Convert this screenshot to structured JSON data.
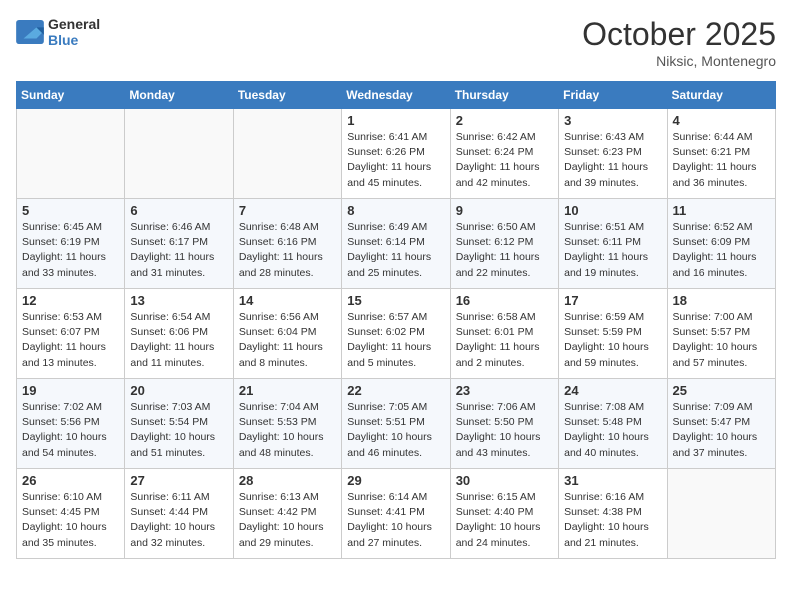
{
  "header": {
    "logo_general": "General",
    "logo_blue": "Blue",
    "month": "October 2025",
    "location": "Niksic, Montenegro"
  },
  "weekdays": [
    "Sunday",
    "Monday",
    "Tuesday",
    "Wednesday",
    "Thursday",
    "Friday",
    "Saturday"
  ],
  "weeks": [
    [
      {
        "day": "",
        "info": ""
      },
      {
        "day": "",
        "info": ""
      },
      {
        "day": "",
        "info": ""
      },
      {
        "day": "1",
        "info": "Sunrise: 6:41 AM\nSunset: 6:26 PM\nDaylight: 11 hours\nand 45 minutes."
      },
      {
        "day": "2",
        "info": "Sunrise: 6:42 AM\nSunset: 6:24 PM\nDaylight: 11 hours\nand 42 minutes."
      },
      {
        "day": "3",
        "info": "Sunrise: 6:43 AM\nSunset: 6:23 PM\nDaylight: 11 hours\nand 39 minutes."
      },
      {
        "day": "4",
        "info": "Sunrise: 6:44 AM\nSunset: 6:21 PM\nDaylight: 11 hours\nand 36 minutes."
      }
    ],
    [
      {
        "day": "5",
        "info": "Sunrise: 6:45 AM\nSunset: 6:19 PM\nDaylight: 11 hours\nand 33 minutes."
      },
      {
        "day": "6",
        "info": "Sunrise: 6:46 AM\nSunset: 6:17 PM\nDaylight: 11 hours\nand 31 minutes."
      },
      {
        "day": "7",
        "info": "Sunrise: 6:48 AM\nSunset: 6:16 PM\nDaylight: 11 hours\nand 28 minutes."
      },
      {
        "day": "8",
        "info": "Sunrise: 6:49 AM\nSunset: 6:14 PM\nDaylight: 11 hours\nand 25 minutes."
      },
      {
        "day": "9",
        "info": "Sunrise: 6:50 AM\nSunset: 6:12 PM\nDaylight: 11 hours\nand 22 minutes."
      },
      {
        "day": "10",
        "info": "Sunrise: 6:51 AM\nSunset: 6:11 PM\nDaylight: 11 hours\nand 19 minutes."
      },
      {
        "day": "11",
        "info": "Sunrise: 6:52 AM\nSunset: 6:09 PM\nDaylight: 11 hours\nand 16 minutes."
      }
    ],
    [
      {
        "day": "12",
        "info": "Sunrise: 6:53 AM\nSunset: 6:07 PM\nDaylight: 11 hours\nand 13 minutes."
      },
      {
        "day": "13",
        "info": "Sunrise: 6:54 AM\nSunset: 6:06 PM\nDaylight: 11 hours\nand 11 minutes."
      },
      {
        "day": "14",
        "info": "Sunrise: 6:56 AM\nSunset: 6:04 PM\nDaylight: 11 hours\nand 8 minutes."
      },
      {
        "day": "15",
        "info": "Sunrise: 6:57 AM\nSunset: 6:02 PM\nDaylight: 11 hours\nand 5 minutes."
      },
      {
        "day": "16",
        "info": "Sunrise: 6:58 AM\nSunset: 6:01 PM\nDaylight: 11 hours\nand 2 minutes."
      },
      {
        "day": "17",
        "info": "Sunrise: 6:59 AM\nSunset: 5:59 PM\nDaylight: 10 hours\nand 59 minutes."
      },
      {
        "day": "18",
        "info": "Sunrise: 7:00 AM\nSunset: 5:57 PM\nDaylight: 10 hours\nand 57 minutes."
      }
    ],
    [
      {
        "day": "19",
        "info": "Sunrise: 7:02 AM\nSunset: 5:56 PM\nDaylight: 10 hours\nand 54 minutes."
      },
      {
        "day": "20",
        "info": "Sunrise: 7:03 AM\nSunset: 5:54 PM\nDaylight: 10 hours\nand 51 minutes."
      },
      {
        "day": "21",
        "info": "Sunrise: 7:04 AM\nSunset: 5:53 PM\nDaylight: 10 hours\nand 48 minutes."
      },
      {
        "day": "22",
        "info": "Sunrise: 7:05 AM\nSunset: 5:51 PM\nDaylight: 10 hours\nand 46 minutes."
      },
      {
        "day": "23",
        "info": "Sunrise: 7:06 AM\nSunset: 5:50 PM\nDaylight: 10 hours\nand 43 minutes."
      },
      {
        "day": "24",
        "info": "Sunrise: 7:08 AM\nSunset: 5:48 PM\nDaylight: 10 hours\nand 40 minutes."
      },
      {
        "day": "25",
        "info": "Sunrise: 7:09 AM\nSunset: 5:47 PM\nDaylight: 10 hours\nand 37 minutes."
      }
    ],
    [
      {
        "day": "26",
        "info": "Sunrise: 6:10 AM\nSunset: 4:45 PM\nDaylight: 10 hours\nand 35 minutes."
      },
      {
        "day": "27",
        "info": "Sunrise: 6:11 AM\nSunset: 4:44 PM\nDaylight: 10 hours\nand 32 minutes."
      },
      {
        "day": "28",
        "info": "Sunrise: 6:13 AM\nSunset: 4:42 PM\nDaylight: 10 hours\nand 29 minutes."
      },
      {
        "day": "29",
        "info": "Sunrise: 6:14 AM\nSunset: 4:41 PM\nDaylight: 10 hours\nand 27 minutes."
      },
      {
        "day": "30",
        "info": "Sunrise: 6:15 AM\nSunset: 4:40 PM\nDaylight: 10 hours\nand 24 minutes."
      },
      {
        "day": "31",
        "info": "Sunrise: 6:16 AM\nSunset: 4:38 PM\nDaylight: 10 hours\nand 21 minutes."
      },
      {
        "day": "",
        "info": ""
      }
    ]
  ]
}
